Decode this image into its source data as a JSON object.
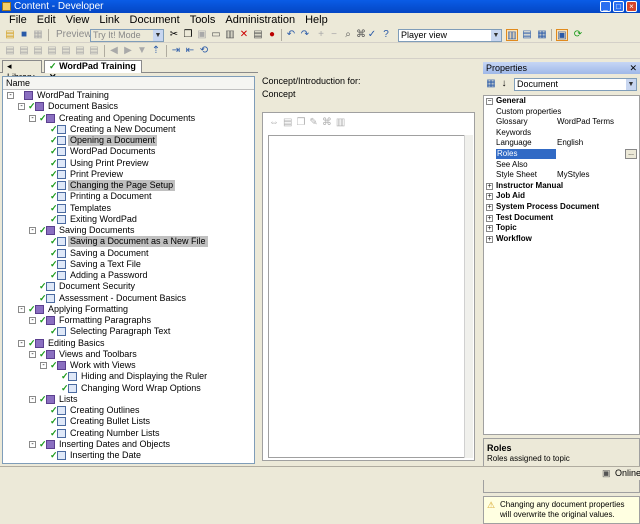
{
  "window": {
    "title": "Content - Developer"
  },
  "menu": [
    "File",
    "Edit",
    "View",
    "Link",
    "Document",
    "Tools",
    "Administration",
    "Help"
  ],
  "toolbar": {
    "preview_label": "Preview",
    "mode_value": "Try It! Mode",
    "view_value": "Player view"
  },
  "tabs": {
    "library": "Library",
    "training": "WordPad Training"
  },
  "tree": {
    "header": "Name",
    "items": [
      {
        "label": "WordPad Training",
        "level": 0,
        "kind": "book",
        "exp": "-",
        "check": false
      },
      {
        "label": "Document Basics",
        "level": 1,
        "kind": "book",
        "exp": "-",
        "check": true
      },
      {
        "label": "Creating and Opening Documents",
        "level": 2,
        "kind": "book",
        "exp": "-",
        "check": true
      },
      {
        "label": "Creating a New Document",
        "level": 3,
        "kind": "topic",
        "check": true
      },
      {
        "label": "Opening a Document",
        "level": 3,
        "kind": "topic",
        "check": true,
        "sel": true
      },
      {
        "label": "WordPad Documents",
        "level": 3,
        "kind": "topic",
        "check": true
      },
      {
        "label": "Using Print Preview",
        "level": 3,
        "kind": "topic",
        "check": true
      },
      {
        "label": "Print Preview",
        "level": 3,
        "kind": "topic",
        "check": true
      },
      {
        "label": "Changing the Page Setup",
        "level": 3,
        "kind": "topic",
        "check": true,
        "sel": true
      },
      {
        "label": "Printing a Document",
        "level": 3,
        "kind": "topic",
        "check": true
      },
      {
        "label": "Templates",
        "level": 3,
        "kind": "topic",
        "check": true
      },
      {
        "label": "Exiting WordPad",
        "level": 3,
        "kind": "topic",
        "check": true
      },
      {
        "label": "Saving Documents",
        "level": 2,
        "kind": "book",
        "exp": "-",
        "check": true
      },
      {
        "label": "Saving a Document as a New File",
        "level": 3,
        "kind": "topic",
        "check": true,
        "sel": true
      },
      {
        "label": "Saving a Document",
        "level": 3,
        "kind": "topic",
        "check": true
      },
      {
        "label": "Saving a Text File",
        "level": 3,
        "kind": "topic",
        "check": true
      },
      {
        "label": "Adding a Password",
        "level": 3,
        "kind": "topic",
        "check": true
      },
      {
        "label": "Document Security",
        "level": 2,
        "kind": "topic",
        "check": true
      },
      {
        "label": "Assessment - Document Basics",
        "level": 2,
        "kind": "topic",
        "check": true
      },
      {
        "label": "Applying Formatting",
        "level": 1,
        "kind": "book",
        "exp": "-",
        "check": true
      },
      {
        "label": "Formatting Paragraphs",
        "level": 2,
        "kind": "book",
        "exp": "-",
        "check": true
      },
      {
        "label": "Selecting Paragraph Text",
        "level": 3,
        "kind": "topic",
        "check": true
      },
      {
        "label": "Editing Basics",
        "level": 1,
        "kind": "book",
        "exp": "-",
        "check": true
      },
      {
        "label": "Views and Toolbars",
        "level": 2,
        "kind": "book",
        "exp": "-",
        "check": true
      },
      {
        "label": "Work with Views",
        "level": 3,
        "kind": "book",
        "exp": "-",
        "check": true
      },
      {
        "label": "Hiding and Displaying the Ruler",
        "level": 4,
        "kind": "topic",
        "check": true
      },
      {
        "label": "Changing Word Wrap Options",
        "level": 4,
        "kind": "topic",
        "check": true
      },
      {
        "label": "Lists",
        "level": 2,
        "kind": "book",
        "exp": "-",
        "check": true
      },
      {
        "label": "Creating Outlines",
        "level": 3,
        "kind": "topic",
        "check": true
      },
      {
        "label": "Creating Bullet Lists",
        "level": 3,
        "kind": "topic",
        "check": true
      },
      {
        "label": "Creating Number Lists",
        "level": 3,
        "kind": "topic",
        "check": true
      },
      {
        "label": "Inserting Dates and Objects",
        "level": 2,
        "kind": "book",
        "exp": "-",
        "check": true
      },
      {
        "label": "Inserting the Date",
        "level": 3,
        "kind": "topic",
        "check": true
      }
    ]
  },
  "concept": {
    "header": "Concept/Introduction for:",
    "label": "Concept"
  },
  "properties": {
    "title": "Properties",
    "object_type": "Document",
    "rows": [
      {
        "type": "cat",
        "name": "General",
        "open": true
      },
      {
        "type": "prop",
        "name": "Custom properties",
        "value": ""
      },
      {
        "type": "prop",
        "name": "Glossary",
        "value": "WordPad Terms"
      },
      {
        "type": "prop",
        "name": "Keywords",
        "value": ""
      },
      {
        "type": "prop",
        "name": "Language",
        "value": "English"
      },
      {
        "type": "prop",
        "name": "Roles",
        "value": "",
        "sel": true
      },
      {
        "type": "prop",
        "name": "See Also",
        "value": ""
      },
      {
        "type": "prop",
        "name": "Style Sheet",
        "value": "MyStyles"
      },
      {
        "type": "cat",
        "name": "Instructor Manual",
        "open": false
      },
      {
        "type": "cat",
        "name": "Job Aid",
        "open": false
      },
      {
        "type": "cat",
        "name": "System Process Document",
        "open": false
      },
      {
        "type": "cat",
        "name": "Test Document",
        "open": false
      },
      {
        "type": "cat",
        "name": "Topic",
        "open": false
      },
      {
        "type": "cat",
        "name": "Workflow",
        "open": false
      }
    ],
    "desc_title": "Roles",
    "desc_text": "Roles assigned to topic",
    "warning": "Changing any document properties will overwrite the original values."
  },
  "status": {
    "text": "Online"
  }
}
